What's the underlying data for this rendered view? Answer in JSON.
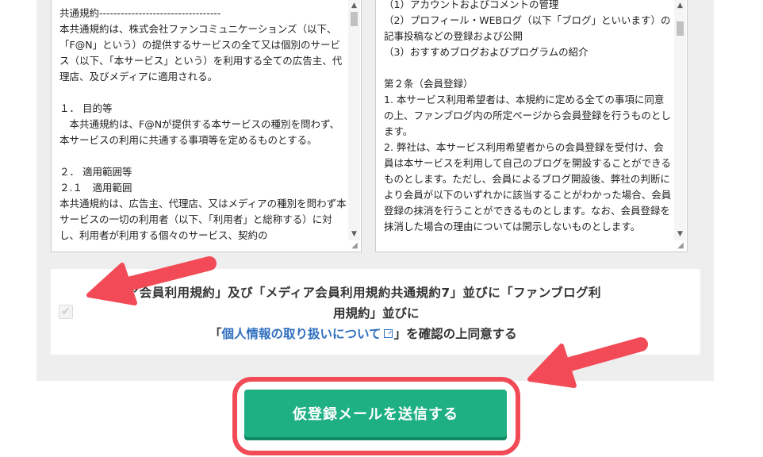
{
  "terms_left": {
    "text": "共通規約----------------------------------\n本共通規約は、株式会社ファンコミュニケーションズ（以下、「F@N」という）の提供するサービスの全て又は個別のサービス（以下、「本サービス」という）を利用する全ての広告主、代理店、及びメディアに適用される。\n\n１． 目的等\n　本共通規約は、F@Nが提供する本サービスの種別を問わず、本サービスの利用に共通する事項等を定めるものとする。\n\n２． 適用範囲等\n２.１　適用範囲\n本共通規約は、広告主、代理店、又はメディアの種別を問わず本サービスの一切の利用者（以下、「利用者」と総称する）に対し、利用者が利用する個々のサービス、契約の"
  },
  "terms_right": {
    "text": "（1）アカウントおよびコメントの管理\n（2）プロフィール・WEBログ（以下「ブログ」といいます）の記事投稿などの登録および公開\n（3）おすすめブログおよびプログラムの紹介\n\n第２条（会員登録）\n1. 本サービス利用希望者は、本規約に定める全ての事項に同意の上、ファンブログ内の所定ページから会員登録を行うものとします。\n2. 弊社は、本サービス利用希望者からの会員登録を受付け、会員は本サービスを利用して自己のブログを開設することができるものとします。ただし、会員によるブログ開設後、弊社の判断により会員が以下のいずれかに該当することがわかった場合、会員登録の抹消を行うことができるものとします。なお、会員登録を抹消した場合の理由については開示しないものとします。"
  },
  "agreement": {
    "line1": "ィア会員利用規約」及び「メディア会員利用規約共通規約7」並びに「ファンブログ利",
    "line2": "用規約」並びに",
    "line3_prefix": "「",
    "link_text": "個人情報の取り扱いについて",
    "line3_suffix": "」を確認の上同意する"
  },
  "submit_label": "仮登録メールを送信する",
  "icons": {
    "checkbox": "check-icon",
    "external_link": "external-link-icon",
    "scroll_up": "arrow-up-icon",
    "scroll_down": "arrow-down-icon"
  },
  "colors": {
    "button": "#1eb082",
    "annotation": "#f24b57",
    "link": "#2f6fbf",
    "panel": "#eeeeee"
  }
}
